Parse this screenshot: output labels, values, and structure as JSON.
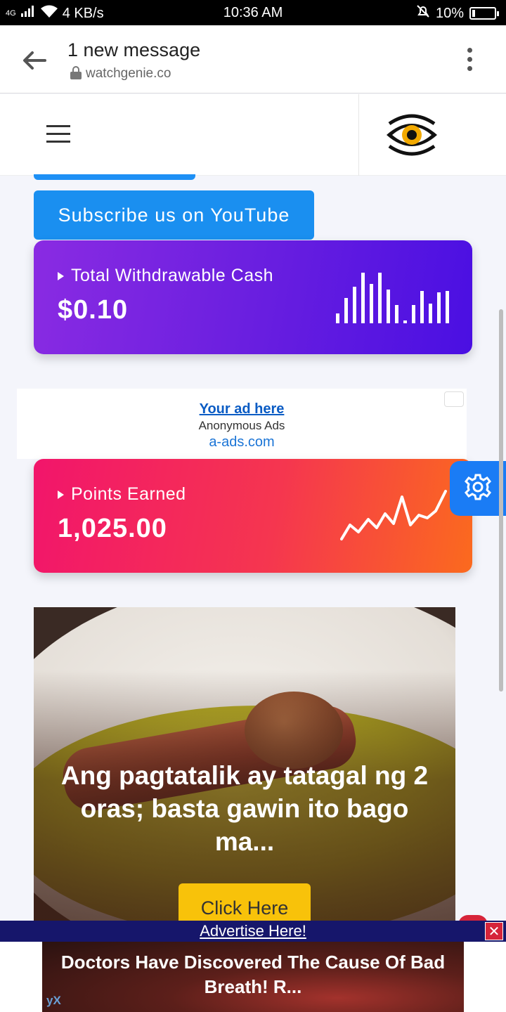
{
  "status_bar": {
    "network": "4G",
    "speed": "4 KB/s",
    "time": "10:36 AM",
    "battery": "10%"
  },
  "browser": {
    "title": "1 new message",
    "url": "watchgenie.co"
  },
  "buttons": {
    "subscribe": "Subscribe us on YouTube"
  },
  "cards": {
    "cash": {
      "label": "Total Withdrawable Cash",
      "value": "$0.10"
    },
    "points": {
      "label": "Points Earned",
      "value": "1,025.00"
    }
  },
  "ad_box": {
    "link": "Your ad here",
    "sub": "Anonymous Ads",
    "domain": "a-ads.com"
  },
  "food_ad": {
    "headline": "Ang pagtatalik ay tatagal ng 2 oras; basta gawin ito bago ma...",
    "cta": "Click Here"
  },
  "advertise_bar": {
    "link": "Advertise Here!",
    "close": "✕"
  },
  "bottom_ad": {
    "text": "Doctors Have Discovered The Cause Of Bad Breath! R...",
    "brand": "yX"
  },
  "colors": {
    "cash_card_start": "#8a2be2",
    "cash_card_end": "#4a0fe2",
    "points_card_start": "#f2156b",
    "points_card_end": "#fb6a1e",
    "accent_blue": "#1a8ff0",
    "cta_yellow": "#f8c20a"
  },
  "icons": {
    "back": "arrow-left-icon",
    "lock": "lock-icon",
    "menu": "more-vert-icon",
    "hamburger": "hamburger-icon",
    "logo": "eye-logo-icon",
    "settings": "gear-icon",
    "bars": "bar-chart-icon",
    "trend": "line-chart-icon"
  }
}
